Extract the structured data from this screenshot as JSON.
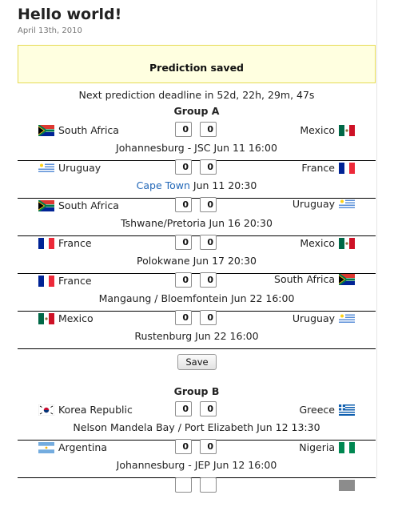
{
  "post": {
    "title": "Hello world!",
    "date": "April 13th, 2010"
  },
  "notice": "Prediction saved",
  "deadline": "Next prediction deadline in 52d, 22h, 29m, 47s",
  "save_label": "Save",
  "groups": [
    {
      "title": "Group A",
      "matches": [
        {
          "home": "South Africa",
          "home_flag": "south-africa-flag-icon",
          "away": "Mexico",
          "away_flag": "mexico-flag-icon",
          "home_score": "0",
          "away_score": "0",
          "venue": "Johannesburg - JSC",
          "time": "Jun 11 16:00"
        },
        {
          "home": "Uruguay",
          "home_flag": "uruguay-flag-icon",
          "away": "France",
          "away_flag": "france-flag-icon",
          "home_score": "0",
          "away_score": "0",
          "venue": "Cape Town",
          "time": "Jun 11 20:30"
        },
        {
          "home": "South Africa",
          "home_flag": "south-africa-flag-icon",
          "away": "Uruguay",
          "away_flag": "uruguay-flag-icon",
          "home_score": "0",
          "away_score": "0",
          "venue": "Tshwane/Pretoria",
          "time": "Jun 16 20:30"
        },
        {
          "home": "France",
          "home_flag": "france-flag-icon",
          "away": "Mexico",
          "away_flag": "mexico-flag-icon",
          "home_score": "0",
          "away_score": "0",
          "venue": "Polokwane",
          "time": "Jun 17 20:30"
        },
        {
          "home": "France",
          "home_flag": "france-flag-icon",
          "away": "South Africa",
          "away_flag": "south-africa-flag-icon",
          "home_score": "0",
          "away_score": "0",
          "venue": "Mangaung / Bloemfontein",
          "time": "Jun 22 16:00"
        },
        {
          "home": "Mexico",
          "home_flag": "mexico-flag-icon",
          "away": "Uruguay",
          "away_flag": "uruguay-flag-icon",
          "home_score": "0",
          "away_score": "0",
          "venue": "Rustenburg",
          "time": "Jun 22 16:00"
        }
      ]
    },
    {
      "title": "Group B",
      "matches": [
        {
          "home": "Korea Republic",
          "home_flag": "korea-flag-icon",
          "away": "Greece",
          "away_flag": "greece-flag-icon",
          "home_score": "0",
          "away_score": "0",
          "venue": "Nelson Mandela Bay / Port Elizabeth",
          "time": "Jun 12 13:30"
        },
        {
          "home": "Argentina",
          "home_flag": "argentina-flag-icon",
          "away": "Nigeria",
          "away_flag": "nigeria-flag-icon",
          "home_score": "0",
          "away_score": "0",
          "venue": "Johannesburg - JEP",
          "time": "Jun 12 16:00"
        }
      ]
    }
  ]
}
